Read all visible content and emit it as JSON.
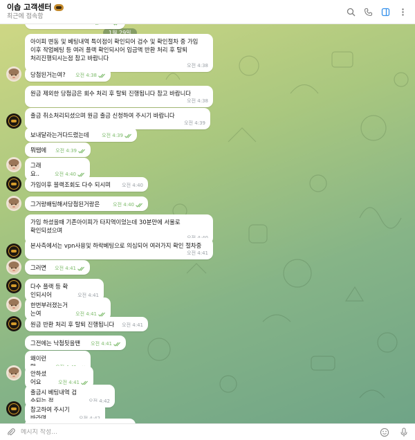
{
  "header": {
    "title": "이솝 고객센터",
    "subtitle": "최근에 접속함",
    "icons": [
      "search-icon",
      "phone-icon",
      "sidebar-toggle-icon",
      "more-vertical-icon"
    ]
  },
  "date_separator": "1월 29일",
  "messages": [
    {
      "sender": "agent",
      "avatar": false,
      "text": "",
      "time": "오전 4:35",
      "read": true
    },
    {
      "sender": "agent",
      "avatar": false,
      "text": "아이피 변동 및 베팅내역 특이점이 확인되어 검수 및 확인절차 중 가입\n이후 작업베팅 등 여러 플랙 확인되시어 입금액 반환 처리 후 탈퇴\n처리진행되시는점 참고 바랍니다",
      "time": "오전 4:38",
      "read": false
    },
    {
      "sender": "user",
      "avatar": true,
      "text": "당첨된거는여?",
      "time": "오전 4:38",
      "read": true
    },
    {
      "sender": "agent",
      "avatar": false,
      "text": "원금 제외한 당첨금은 회수 처리 후 탈퇴 진행됩니다 참고 바랍니다",
      "time": "오전 4:38",
      "read": false
    },
    {
      "sender": "agent",
      "avatar": true,
      "text": "출금 취소처리되셨으며 원금 출금 신청하여 주시기 바랍니다",
      "time": "오전 4:39",
      "read": false
    },
    {
      "sender": "user",
      "avatar": false,
      "text": "보내달라는거다드렸는데",
      "time": "오전 4:39",
      "read": true
    },
    {
      "sender": "user",
      "avatar": false,
      "text": "뭐뗌에",
      "time": "오전 4:39",
      "read": true
    },
    {
      "sender": "user",
      "avatar": true,
      "text": "그래요..",
      "time": "오전 4:40",
      "read": true
    },
    {
      "sender": "agent",
      "avatar": true,
      "text": "가입이후 블랙조회도 다수 되시며",
      "time": "오전 4:40",
      "read": false
    },
    {
      "sender": "user",
      "avatar": true,
      "text": "그거랑배팅해서당첨된거랑은",
      "time": "오전 4:40",
      "read": true
    },
    {
      "sender": "agent",
      "avatar": false,
      "text": "가입 하셨을때 기존아이피가 타지역이었는데 30분만에 서울로\n확인되셨으며",
      "time": "오전 4:40",
      "read": false
    },
    {
      "sender": "agent",
      "avatar": true,
      "text": "본사측에서는 vpn사용및 하락베팅으로 의심되어 여러가지 확인 절차중",
      "time": "오전 4:41",
      "read": false
    },
    {
      "sender": "user",
      "avatar": true,
      "text": "그러면",
      "time": "오전 4:41",
      "read": true
    },
    {
      "sender": "agent",
      "avatar": true,
      "text": "다수 플랙 등 확인되시어",
      "time": "오전 4:41",
      "read": false
    },
    {
      "sender": "user",
      "avatar": true,
      "text": "한번부러졌는거는여",
      "time": "오전 4:41",
      "read": true
    },
    {
      "sender": "agent",
      "avatar": true,
      "text": "원금 반환 처리 후 탈퇴 진행됩니다",
      "time": "오전 4:41",
      "read": false
    },
    {
      "sender": "user",
      "avatar": false,
      "text": "그전에는 낙첨됫을땐",
      "time": "오전 4:41",
      "read": true
    },
    {
      "sender": "user",
      "avatar": false,
      "text": "왜이런말",
      "time": "오전 4:41",
      "read": true
    },
    {
      "sender": "user",
      "avatar": true,
      "text": "안하셨어요",
      "time": "오전 4:41",
      "read": true
    },
    {
      "sender": "agent",
      "avatar": false,
      "text": "출금시 베팅내역 검수되는 점",
      "time": "오전 4:42",
      "read": false
    },
    {
      "sender": "agent",
      "avatar": true,
      "text": "참고하여 주시기 바라며",
      "time": "오전 4:42",
      "read": false
    },
    {
      "sender": "agent",
      "avatar": false,
      "text": "",
      "time": "",
      "read": false
    }
  ],
  "composer": {
    "placeholder": "메시지 작성..."
  },
  "colors": {
    "check_green": "#7dbb6b",
    "agent_avatar": "#1d1710",
    "header_icon_active": "#3390ec"
  }
}
